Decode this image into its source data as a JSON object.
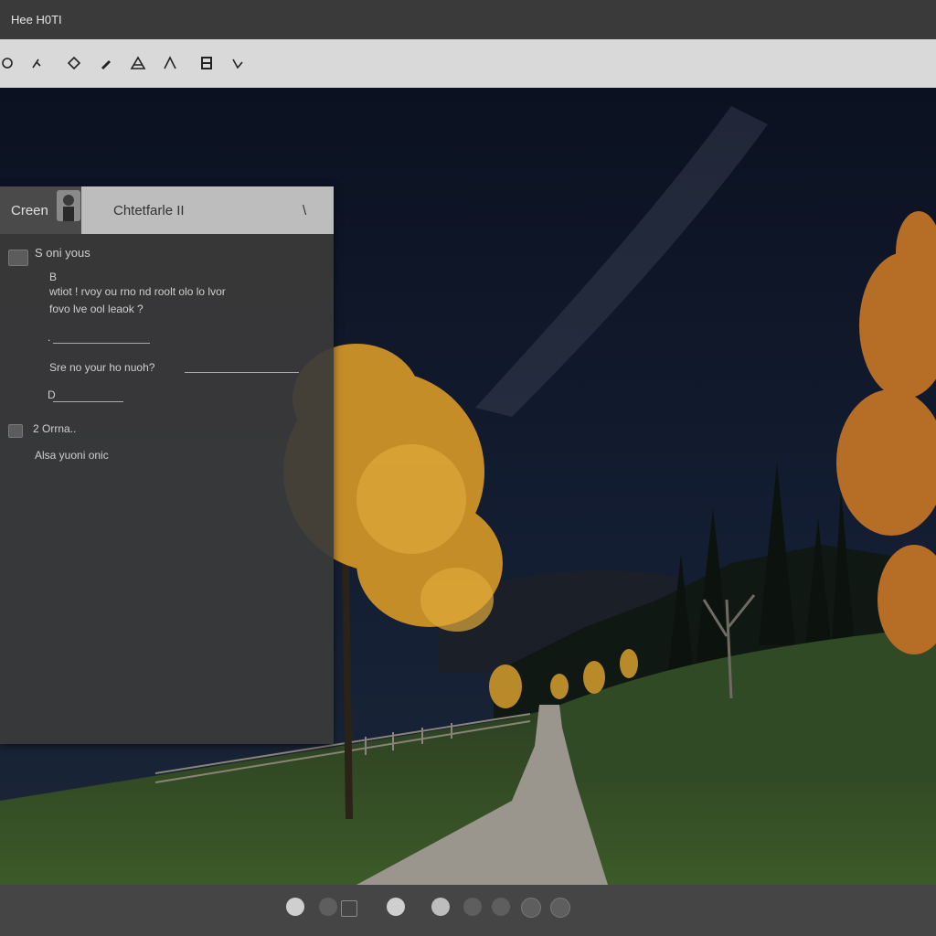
{
  "window": {
    "title": "Hee H0TI"
  },
  "toolbar": {
    "tools": [
      {
        "icon": "circle-icon"
      },
      {
        "icon": "run-icon"
      },
      {
        "icon": "diamond-icon"
      },
      {
        "icon": "pencil-icon"
      },
      {
        "icon": "triangle-icon"
      },
      {
        "icon": "caret-up-icon"
      },
      {
        "icon": "box-icon"
      },
      {
        "icon": "check-icon"
      }
    ]
  },
  "dialog": {
    "tab_label": "Creen",
    "title": "Chtetfarle II",
    "close_label": "\\",
    "section1": {
      "heading": "S oni yous",
      "marker": "B",
      "question_line1": "wtiot ! rvoy ou rno nd roolt olo lo lvor",
      "question_line2": "fovo lve ool leaok ?",
      "blank_prefix": ".",
      "prompt": "Sre no your ho nuoh?",
      "blank2_prefix": "D"
    },
    "section2": {
      "heading": "2 Orrna..",
      "subtext": "Alsa yuoni onic"
    }
  },
  "pagination": {
    "dots": 9,
    "active_color": "#cfcfcf",
    "inactive_color": "#5e5e5e"
  }
}
